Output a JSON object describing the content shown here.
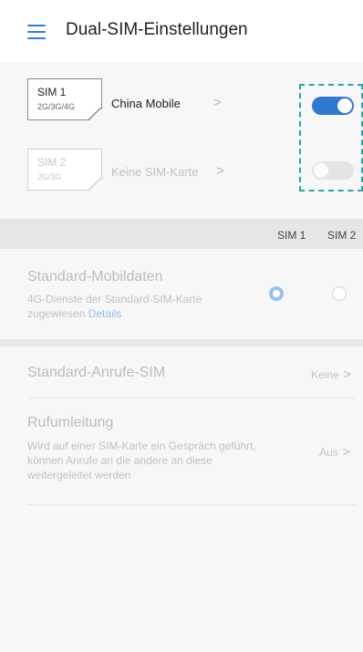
{
  "app_bar": {
    "title": "Dual-SIM-Einstellungen",
    "menu_icon": "hamburger-menu-icon",
    "accent": "#2f7fd6"
  },
  "sims": [
    {
      "slot": "SIM 1",
      "network": "2G/3G/4G",
      "carrier": "China Mobile",
      "enabled": true
    },
    {
      "slot": "SIM 2",
      "network": "2G/3G",
      "carrier": "Keine SIM-Karte",
      "enabled": false
    }
  ],
  "columns": {
    "sim1": "SIM 1",
    "sim2": "SIM 2"
  },
  "mobile_data": {
    "title": "Standard-Mobildaten",
    "subtitle": "4G-Dienste der Standard-SIM-Karte zugewiesen",
    "details_link": "Details",
    "selected": "SIM 1"
  },
  "call_sim": {
    "title": "Standard-Anrufe-SIM",
    "value": "Keine"
  },
  "forwarding": {
    "title": "Rufumleitung",
    "description": "Wird auf einer SIM-Karte ein Gespräch geführt, können Anrufe an die andere an diese weitergeleitet werden",
    "value": "Aus"
  },
  "colors": {
    "toggle_on": "#2f78d3",
    "toggle_off": "#e4e4e4",
    "highlight": "#2ba4a8",
    "background": "#f7f7f7"
  }
}
